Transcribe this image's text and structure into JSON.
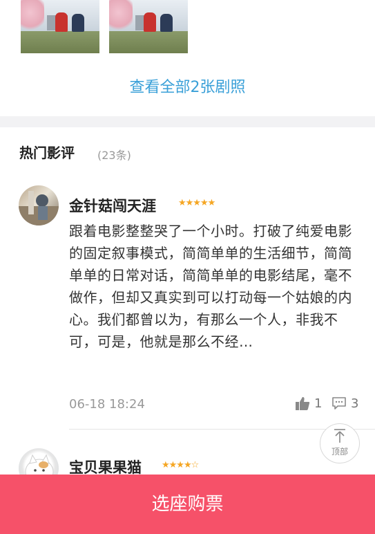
{
  "stills": {
    "view_all_label": "查看全部2张剧照"
  },
  "reviews": {
    "title": "热门影评",
    "count": "(23条)",
    "items": [
      {
        "username": "金针菇闯天涯",
        "stars": "★★★★★",
        "rating": 5,
        "text": "跟着电影整整哭了一个小时。打破了纯爱电影的固定叙事模式，简简单单的生活细节，简简单单的日常对话，简简单单的电影结尾，毫不做作，但却又真实到可以打动每一个姑娘的内心。我们都曾以为，有那么一个人，非我不可，可是，他就是那么不经…",
        "time": "06-18 18:24",
        "likes": "1",
        "comments": "3"
      },
      {
        "username": "宝贝果果猫",
        "stars": "★★★★☆",
        "rating": 4
      }
    ]
  },
  "back_to_top": {
    "label": "顶部"
  },
  "buy_button": {
    "label": "选座购票"
  },
  "colors": {
    "accent_blue": "#3aa0d8",
    "star": "#f5a623",
    "buy_bar": "#f65169"
  }
}
